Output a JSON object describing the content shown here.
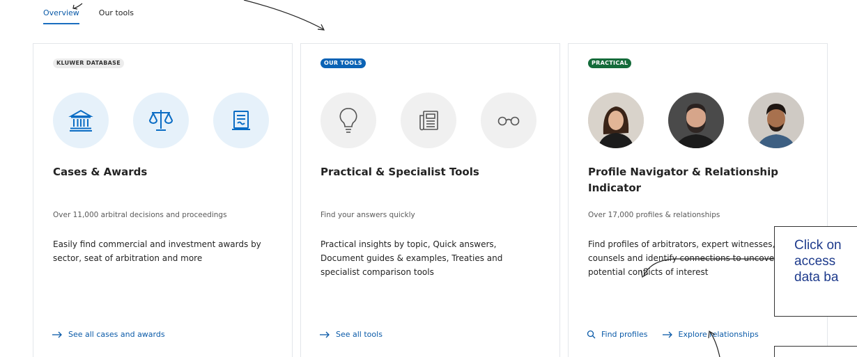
{
  "tabs": [
    {
      "label": "Overview",
      "active": true
    },
    {
      "label": "Our tools",
      "active": false
    }
  ],
  "cards": [
    {
      "badge": "KLUWER DATABASE",
      "icons": [
        "bank-icon",
        "scales-icon",
        "document-icon"
      ],
      "title": "Cases & Awards",
      "subtitle": "Over 11,000 arbitral decisions and proceedings",
      "description": "Easily find commercial and investment awards by sector, seat of arbitration and more",
      "links": [
        {
          "label": "See all cases and awards",
          "icon": "arrow-right-icon"
        }
      ]
    },
    {
      "badge": "OUR TOOLS",
      "icons": [
        "lightbulb-icon",
        "newspaper-icon",
        "glasses-icon"
      ],
      "title": "Practical & Specialist Tools",
      "subtitle": "Find your answers quickly",
      "description": "Practical insights by topic, Quick answers, Document guides & examples, Treaties and specialist comparison tools",
      "links": [
        {
          "label": "See all tools",
          "icon": "arrow-right-icon"
        }
      ]
    },
    {
      "badge": "PRACTICAL",
      "icons": [
        "avatar-woman",
        "avatar-bearded-man",
        "avatar-smiling-man"
      ],
      "title": "Profile Navigator & Relationship Indicator",
      "subtitle": "Over 17,000 profiles & relationships",
      "description": "Find profiles of arbitrators, expert witnesses, counsels and identify connections to uncover potential conflicts of interest",
      "links": [
        {
          "label": "Find profiles",
          "icon": "search-icon"
        },
        {
          "label": "Explore relationships",
          "icon": "arrow-right-icon"
        }
      ]
    }
  ],
  "annotation": {
    "line1": "Click on",
    "line2": "access",
    "line3": "data ba"
  },
  "colors": {
    "accent": "#0a5aa8",
    "badge_blue": "#0b63b5",
    "badge_green": "#146b3a",
    "note_text": "#1e3b8c"
  }
}
